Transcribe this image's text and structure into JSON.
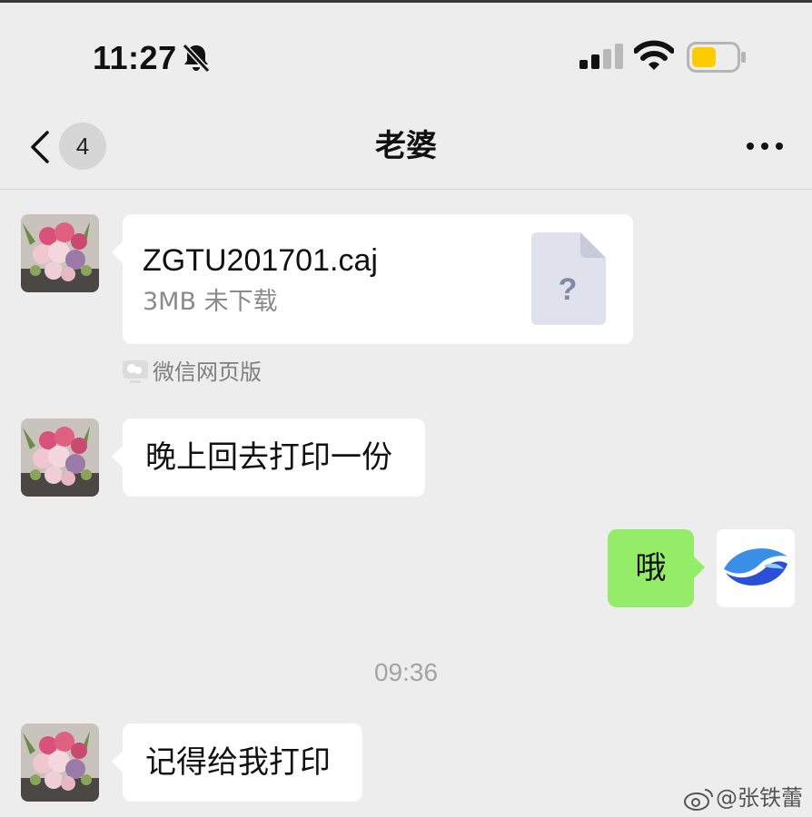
{
  "status_bar": {
    "time": "11:27",
    "bell_icon": "bell-slash-icon",
    "signal_icon": "cellular-signal-icon",
    "wifi_icon": "wifi-icon",
    "battery_icon": "battery-icon",
    "battery_level": 0.55,
    "battery_color": "#ffcc00"
  },
  "nav": {
    "back_icon": "chevron-left-icon",
    "unread_count": "4",
    "title": "老婆",
    "more_icon": "ellipsis-icon"
  },
  "messages": [
    {
      "side": "left",
      "type": "file",
      "file_name": "ZGTU201701.caj",
      "file_meta": "3MB  未下载",
      "file_icon": "unknown-file-icon",
      "source_label": "微信网页版"
    },
    {
      "side": "left",
      "type": "text",
      "text": "晚上回去打印一份"
    },
    {
      "side": "right",
      "type": "text",
      "text": "哦"
    },
    {
      "side": "left",
      "type": "text",
      "text": "记得给我打印"
    }
  ],
  "timestamp": "09:36",
  "watermark": "@张铁蕾",
  "colors": {
    "background": "#ededed",
    "sent_bubble": "#95ec69",
    "received_bubble": "#ffffff"
  }
}
